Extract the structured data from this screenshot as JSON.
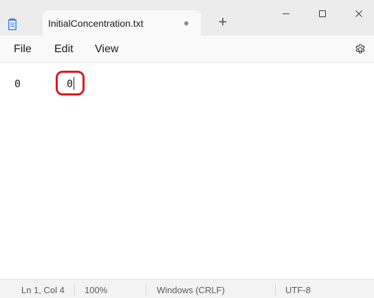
{
  "window": {
    "tab_title": "InitialConcentration.txt",
    "new_tab_label": "+",
    "unsaved_indicator": "dot"
  },
  "menu": {
    "file": "File",
    "edit": "Edit",
    "view": "View"
  },
  "editor": {
    "line1_col1": "0",
    "line1_col2": "0"
  },
  "status": {
    "position": "Ln 1, Col 4",
    "zoom": "100%",
    "line_ending": "Windows (CRLF)",
    "encoding": "UTF-8"
  },
  "icons": {
    "app": "notepad-icon",
    "settings": "gear-icon",
    "minimize": "minimize-icon",
    "maximize": "maximize-icon",
    "close": "close-icon"
  },
  "colors": {
    "highlight": "#e0141e",
    "notepad_blue": "#4a90d9"
  }
}
